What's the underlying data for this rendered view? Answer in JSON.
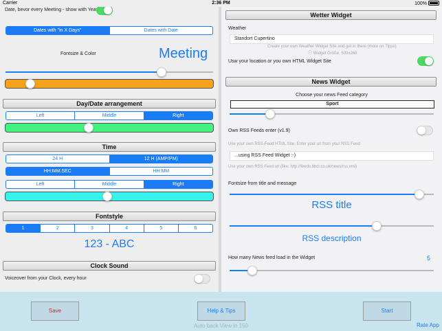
{
  "status": {
    "carrier": "Carrier",
    "time": "2:36 PM",
    "battery": "100%"
  },
  "left": {
    "meeting_toggle_label": "Date, bevor every Meeting - show with Year ?",
    "date_mode_tabs": [
      "Dates with \"in X Days\"",
      "Dates with Date"
    ],
    "fontsize_color_label": "Fontsize & Color",
    "meeting_preview": "Meeting",
    "meeting_fontsize_slider": 0.75,
    "meeting_color_bar": {
      "color": "#f5a21c",
      "level": 0.12
    },
    "daydate_header": "Day/Date arrangement",
    "daydate_align_tabs": [
      "Left",
      "Middle",
      "Right"
    ],
    "daydate_color_bar": {
      "color": "#44f37f",
      "level": 0.4
    },
    "time_header": "Time",
    "time_format_tabs": [
      "24 H",
      "12 H (AMP/PM)"
    ],
    "time_seconds_tabs": [
      "HH:MM:SEC",
      "HH:MM"
    ],
    "time_align_tabs": [
      "Left",
      "Middle",
      "Right"
    ],
    "time_color_bar": {
      "color": "#35f2ea",
      "level": 0.49
    },
    "fontstyle_header": "Fontstyle",
    "fontstyle_tabs": [
      "1",
      "2",
      "3",
      "4",
      "5",
      "6"
    ],
    "fontstyle_preview": "123 - ABC",
    "clock_sound_header": "Clock Sound",
    "voiceover_label": "Voiceover from your Clock, every hour"
  },
  "right": {
    "weather_header": "Wetter Widget",
    "weather_label": "Weather",
    "weather_value": "Standort Cupertino",
    "weather_hint": "Create your own Weather Widget Site and get in there (more on Tipps)",
    "weather_size_hint": "Widget Größe: 500x260",
    "location_label": "Usw your location or you own HTML Widget Site",
    "news_header": "News Widget",
    "news_category_label": "Choose your news Feed category",
    "news_category_value": "Sport",
    "news_category_slider": 0.2,
    "own_rss_label": "Own RSS Feeds enter (v1.9)",
    "own_rss_hint": "Use your own RSS-Feed HTML Site, Enter your url from your RSS Feed",
    "rss_input_value": "...using RSS Feed Widget :-)",
    "rss_url_hint": "Use your own RSS Feed url (like: http://feeds.bbci.co.uk/news/rss.xml)",
    "fontsize_label": "Fontsize from title and message",
    "title_slider": 0.93,
    "rss_title_preview": "RSS title",
    "desc_slider": 0.72,
    "rss_desc_preview": "RSS description",
    "news_count_label": "How many News feed load in the Widget",
    "news_count_value": "5",
    "news_count_slider": 0.11
  },
  "bottom": {
    "save": "Save",
    "help": "Help & Tips",
    "start": "Start",
    "auto_back": "Auto back View in 150",
    "rate": "Rate App"
  },
  "colors": {
    "accent": "#1a7cf5",
    "toggle_on": "#4cd964",
    "save_red": "#e0201b"
  }
}
